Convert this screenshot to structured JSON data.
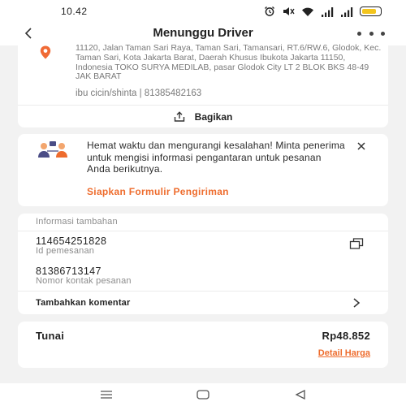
{
  "status_bar": {
    "time": "10.42",
    "icons": [
      "alarm-icon",
      "mute-icon",
      "wifi-icon",
      "signal-icon",
      "signal-icon",
      "battery-icon"
    ],
    "battery_level": 0.85,
    "battery_color": "#f3c51d"
  },
  "header": {
    "title": "Menunggu Driver",
    "back_icon": "chevron-left-icon",
    "more_icon": "more-horizontal-icon"
  },
  "address": {
    "text": "11120, Jalan Taman Sari Raya, Taman Sari, Tamansari, RT.6/RW.6, Glodok, Kec. Taman Sari, Kota Jakarta Barat, Daerah Khusus Ibukota Jakarta 11150, Indonesia TOKO SURYA MEDILAB, pasar Glodok City LT 2 BLOK BKS 48-49 JAK BARAT",
    "recipient": "ibu cicin/shinta | 81385482163",
    "share_label": "Bagikan"
  },
  "promo": {
    "message": "Hemat waktu dan mengurangi kesalahan! Minta penerima untuk mengisi informasi pengantaran untuk pesanan Anda berikutnya.",
    "link_label": "Siapkan Formulir Pengiriman"
  },
  "info": {
    "title": "Informasi tambahan",
    "order_id": "114654251828",
    "order_id_label": "Id pemesanan",
    "contact_number": "81386713147",
    "contact_label": "Nomor kontak pesanan",
    "comment_label": "Tambahkan komentar"
  },
  "payment": {
    "method": "Tunai",
    "amount": "Rp48.852",
    "detail_label": "Detail Harga"
  },
  "colors": {
    "accent": "#ee6c2d",
    "pin": "#f06a35"
  }
}
